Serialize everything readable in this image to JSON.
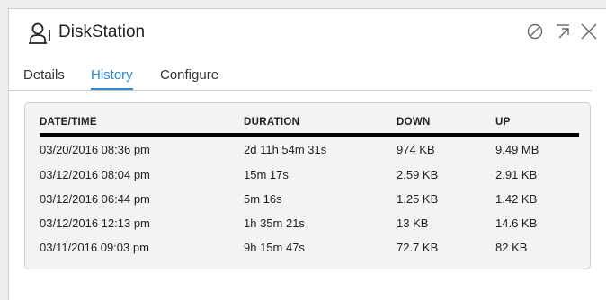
{
  "window": {
    "title": "DiskStation",
    "icon": "device-user-icon",
    "controls": [
      "disable-icon",
      "popout-icon",
      "close-icon"
    ]
  },
  "tabs": [
    {
      "label": "Details",
      "active": false
    },
    {
      "label": "History",
      "active": true
    },
    {
      "label": "Configure",
      "active": false
    }
  ],
  "accent_color": "#2f86d1",
  "history": {
    "columns": [
      "DATE/TIME",
      "DURATION",
      "DOWN",
      "UP"
    ],
    "rows": [
      [
        "03/20/2016 08:36 pm",
        "2d 11h 54m 31s",
        "974 KB",
        "9.49 MB"
      ],
      [
        "03/12/2016 08:04 pm",
        "15m 17s",
        "2.59 KB",
        "2.91 KB"
      ],
      [
        "03/12/2016 06:44 pm",
        "5m 16s",
        "1.25 KB",
        "1.42 KB"
      ],
      [
        "03/12/2016 12:13 pm",
        "1h 35m 21s",
        "13 KB",
        "14.6 KB"
      ],
      [
        "03/11/2016 09:03 pm",
        "9h 15m 47s",
        "72.7 KB",
        "82 KB"
      ]
    ]
  }
}
